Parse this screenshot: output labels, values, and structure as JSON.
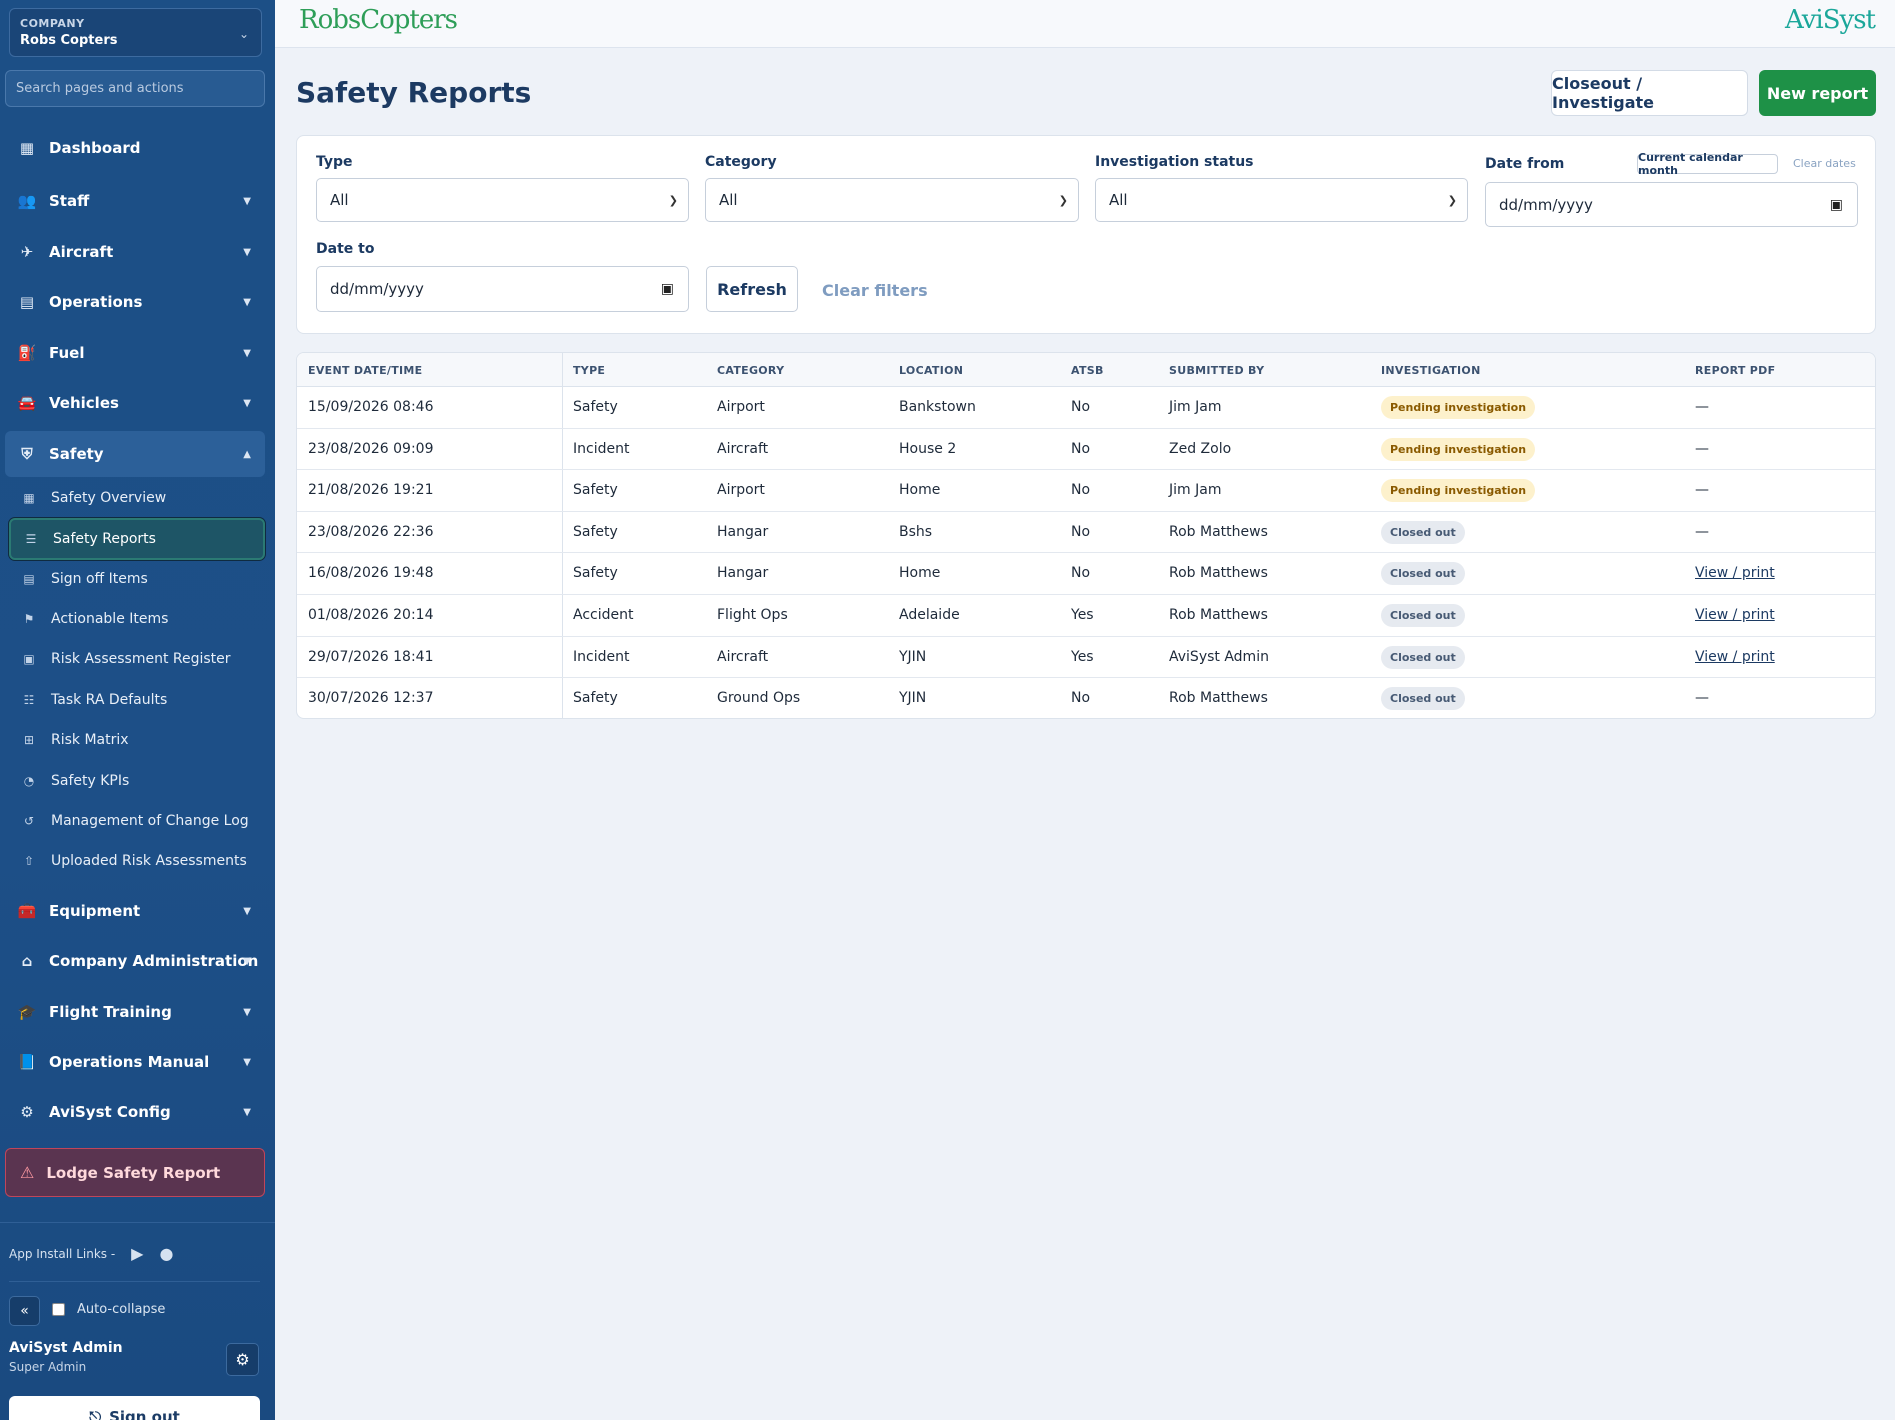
{
  "company": {
    "label": "COMPANY",
    "name": "Robs Copters"
  },
  "search": {
    "placeholder": "Search pages and actions"
  },
  "nav": {
    "dashboard": "Dashboard",
    "staff": "Staff",
    "aircraft": "Aircraft",
    "operations": "Operations",
    "fuel": "Fuel",
    "vehicles": "Vehicles",
    "safety": "Safety",
    "equipment": "Equipment",
    "company_admin": "Company Administration",
    "flight_training": "Flight Training",
    "ops_manual": "Operations Manual",
    "avisyst_config": "AviSyst Config"
  },
  "safety_sub": [
    "Safety Overview",
    "Safety Reports",
    "Sign off Items",
    "Actionable Items",
    "Risk Assessment Register",
    "Task RA Defaults",
    "Risk Matrix",
    "Safety KPIs",
    "Management of Change Log",
    "Uploaded Risk Assessments"
  ],
  "lodge": "Lodge Safety Report",
  "app_links": "App Install Links -",
  "collapse": "«",
  "auto_collapse": "Auto-collapse",
  "user": {
    "name": "AviSyst Admin",
    "role": "Super Admin"
  },
  "signout": "Sign out",
  "topbar": {
    "left_logo": "RobsCopters",
    "right_logo": "AviSyst"
  },
  "page": {
    "title": "Safety Reports",
    "closeout_btn": "Closeout / Investigate",
    "new_btn": "New report"
  },
  "filters": {
    "type_label": "Type",
    "type_value": "All",
    "category_label": "Category",
    "category_value": "All",
    "status_label": "Investigation status",
    "status_value": "All",
    "date_from_label": "Date from",
    "date_from_value": "dd/mm/yyyy",
    "current_month": "Current calendar month",
    "clear_dates": "Clear dates",
    "date_to_label": "Date to",
    "date_to_value": "dd/mm/yyyy",
    "refresh": "Refresh",
    "clear_filters": "Clear filters"
  },
  "table": {
    "headers": [
      "EVENT DATE/TIME",
      "TYPE",
      "CATEGORY",
      "LOCATION",
      "ATSB",
      "SUBMITTED BY",
      "INVESTIGATION",
      "REPORT PDF"
    ],
    "rows": [
      [
        "15/09/2026 08:46",
        "Safety",
        "Airport",
        "Bankstown",
        "No",
        "Jim Jam",
        "Pending investigation",
        "—"
      ],
      [
        "23/08/2026 09:09",
        "Incident",
        "Aircraft",
        "House 2",
        "No",
        "Zed Zolo",
        "Pending investigation",
        "—"
      ],
      [
        "21/08/2026 19:21",
        "Safety",
        "Airport",
        "Home",
        "No",
        "Jim Jam",
        "Pending investigation",
        "—"
      ],
      [
        "23/08/2026 22:36",
        "Safety",
        "Hangar",
        "Bshs",
        "No",
        "Rob Matthews",
        "Closed out",
        "—"
      ],
      [
        "16/08/2026 19:48",
        "Safety",
        "Hangar",
        "Home",
        "No",
        "Rob Matthews",
        "Closed out",
        "View / print"
      ],
      [
        "01/08/2026 20:14",
        "Accident",
        "Flight Ops",
        "Adelaide",
        "Yes",
        "Rob Matthews",
        "Closed out",
        "View / print"
      ],
      [
        "29/07/2026 18:41",
        "Incident",
        "Aircraft",
        "YJIN",
        "Yes",
        "AviSyst Admin",
        "Closed out",
        "View / print"
      ],
      [
        "30/07/2026 12:37",
        "Safety",
        "Ground Ops",
        "YJIN",
        "No",
        "Rob Matthews",
        "Closed out",
        "—"
      ]
    ]
  }
}
